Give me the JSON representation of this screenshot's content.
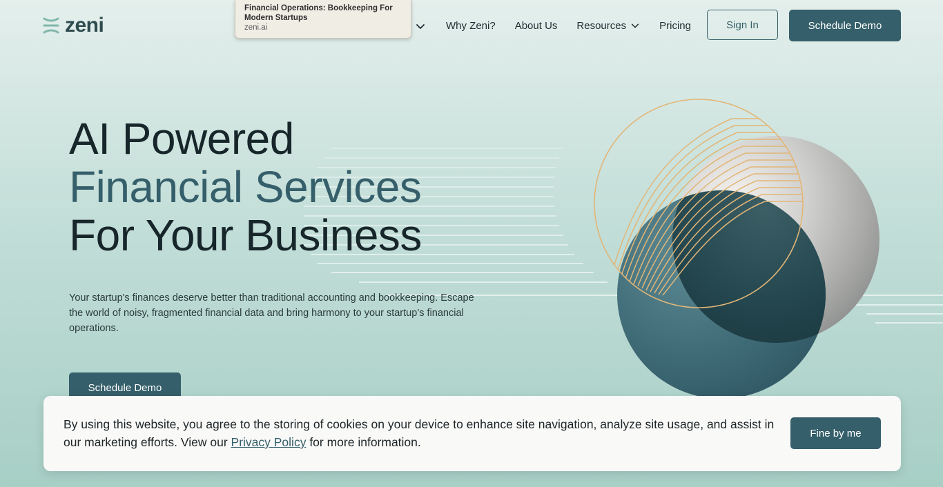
{
  "tooltip": {
    "title": "Financial Operations: Bookkeeping For Modern Startups",
    "url": "zeni.ai"
  },
  "header": {
    "logo_text": "zeni",
    "nav": [
      {
        "label": "Why Zeni?",
        "has_dropdown": false
      },
      {
        "label": "About Us",
        "has_dropdown": false
      },
      {
        "label": "Resources",
        "has_dropdown": true
      },
      {
        "label": "Pricing",
        "has_dropdown": false
      }
    ],
    "sign_in_label": "Sign In",
    "schedule_demo_label": "Schedule Demo"
  },
  "hero": {
    "title_line1": "AI Powered",
    "title_line2": "Financial Services",
    "title_line3": "For Your Business",
    "subtitle": "Your startup's finances deserve better than traditional accounting and bookkeeping. Escape the world of noisy, fragmented financial data and bring harmony to your startup’s financial operations.",
    "cta_label": "Schedule Demo"
  },
  "cookie_banner": {
    "text_before": "By using this website, you agree to the storing of cookies on your device to enhance site navigation, analyze site usage, and assist in our marketing efforts. View our ",
    "link_label": "Privacy Policy",
    "text_after": " for more information.",
    "accept_label": "Fine by me"
  },
  "colors": {
    "brand": "#355f6a",
    "accent_gold": "#e2b678",
    "background": "#b5d6cf"
  },
  "icons": {
    "logo": "zeni-logo-icon",
    "dropdown": "chevron-down-icon"
  }
}
